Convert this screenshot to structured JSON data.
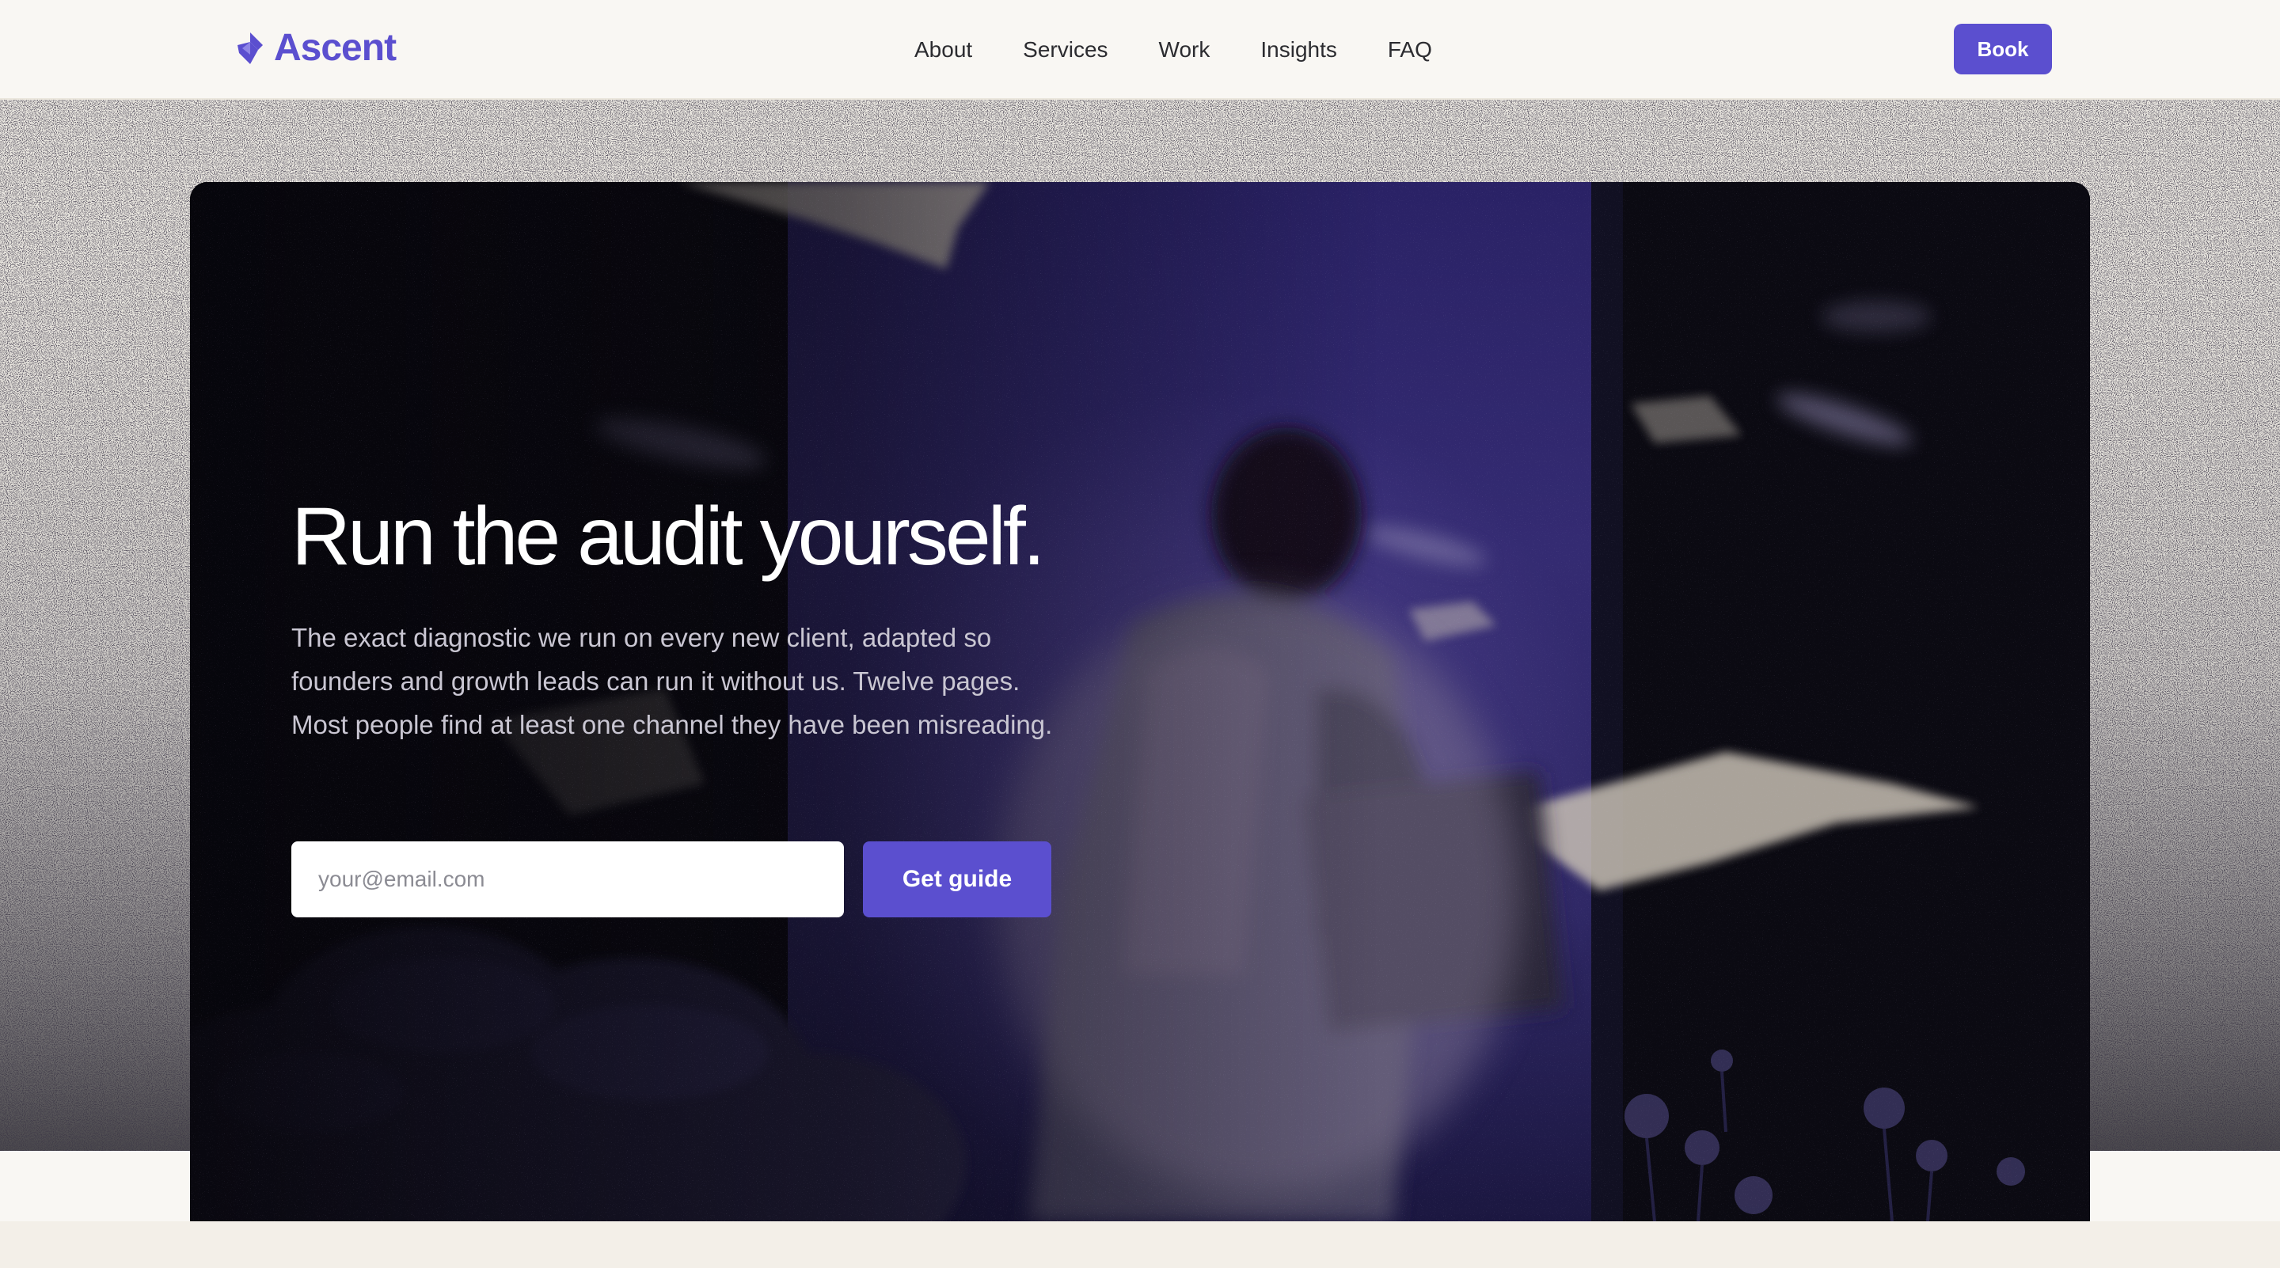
{
  "brand": {
    "name": "Ascent",
    "logo_icon": "mountain-peak-icon",
    "accent_color": "#5b4fcf"
  },
  "nav": {
    "links": [
      {
        "label": "About"
      },
      {
        "label": "Services"
      },
      {
        "label": "Work"
      },
      {
        "label": "Insights"
      },
      {
        "label": "FAQ"
      }
    ],
    "book_label": "Book"
  },
  "hero": {
    "title": "Run the audit yourself.",
    "subtitle": "The exact diagnostic we run on every new client, adapted so founders and growth leads can run it without us. Twelve pages. Most people find at least one channel they have been misreading.",
    "email_placeholder": "your@email.com",
    "cta_label": "Get guide"
  },
  "colors": {
    "page_bg": "#f9f7f3",
    "hero_bg": "#0a0910",
    "button": "#5b4fcf"
  }
}
